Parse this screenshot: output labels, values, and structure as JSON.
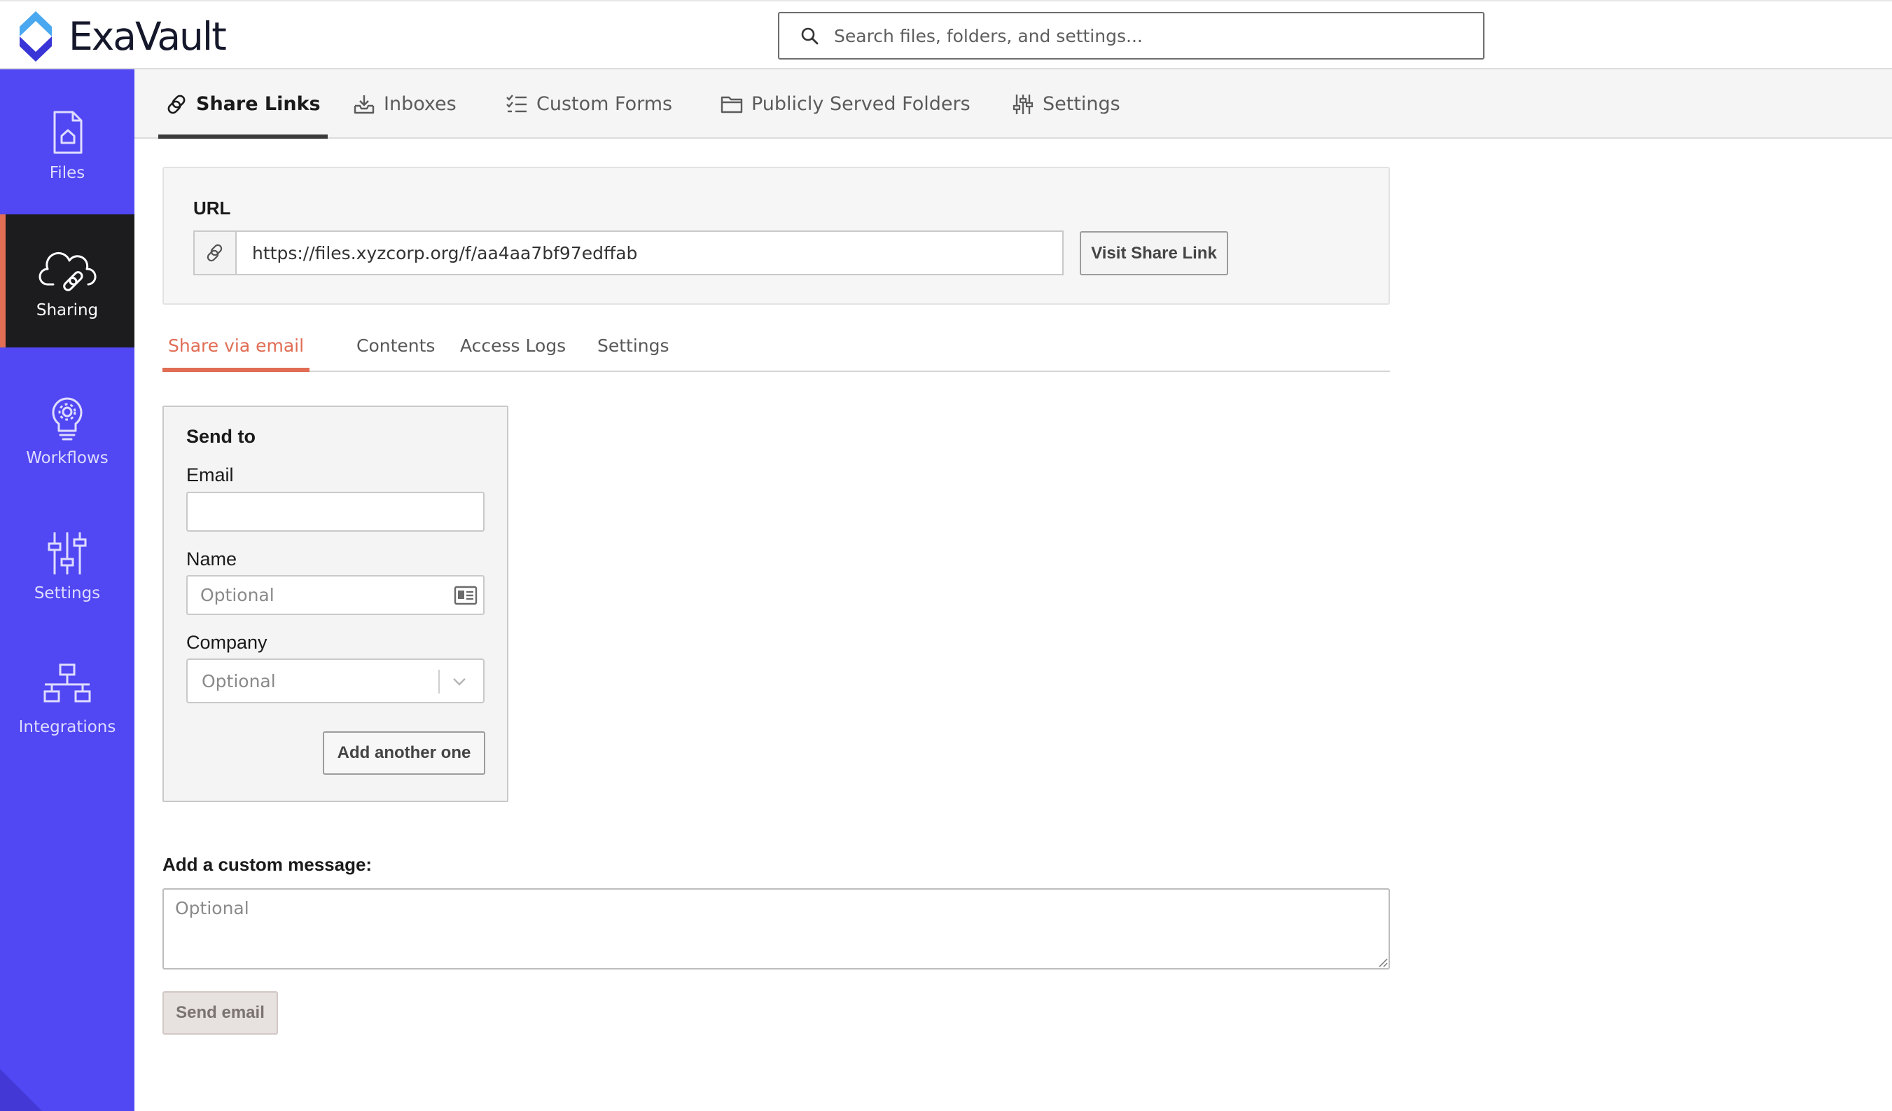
{
  "app": {
    "name": "ExaVault",
    "brand_color": "#5147f3",
    "accent_color": "#e06d54"
  },
  "search": {
    "placeholder": "Search files, folders, and settings...",
    "icon": "search-icon"
  },
  "sidebar": {
    "items": [
      {
        "label": "Files",
        "icon": "file-home-icon",
        "active": false
      },
      {
        "label": "Sharing",
        "icon": "cloud-link-icon",
        "active": true
      },
      {
        "label": "Workflows",
        "icon": "lightbulb-gear-icon",
        "active": false
      },
      {
        "label": "Settings",
        "icon": "sliders-icon",
        "active": false
      },
      {
        "label": "Integrations",
        "icon": "network-icon",
        "active": false
      }
    ]
  },
  "top_tabs": [
    {
      "label": "Share Links",
      "icon": "link-icon",
      "active": true
    },
    {
      "label": "Inboxes",
      "icon": "inbox-download-icon",
      "active": false
    },
    {
      "label": "Custom Forms",
      "icon": "checklist-icon",
      "active": false
    },
    {
      "label": "Publicly Served Folders",
      "icon": "folder-icon",
      "active": false
    },
    {
      "label": "Settings",
      "icon": "sliders-icon",
      "active": false
    }
  ],
  "url_section": {
    "label": "URL",
    "value": "https://files.xyzcorp.org/f/aa4aa7bf97edffab",
    "visit_button": "Visit Share Link"
  },
  "sub_tabs": [
    {
      "label": "Share via email",
      "active": true
    },
    {
      "label": "Contents",
      "active": false
    },
    {
      "label": "Access Logs",
      "active": false
    },
    {
      "label": "Settings",
      "active": false
    }
  ],
  "send_to": {
    "title": "Send to",
    "email_label": "Email",
    "email_value": "",
    "name_label": "Name",
    "name_placeholder": "Optional",
    "company_label": "Company",
    "company_placeholder": "Optional",
    "add_button": "Add another one"
  },
  "message": {
    "label": "Add a custom message:",
    "placeholder": "Optional"
  },
  "send_button": "Send email"
}
